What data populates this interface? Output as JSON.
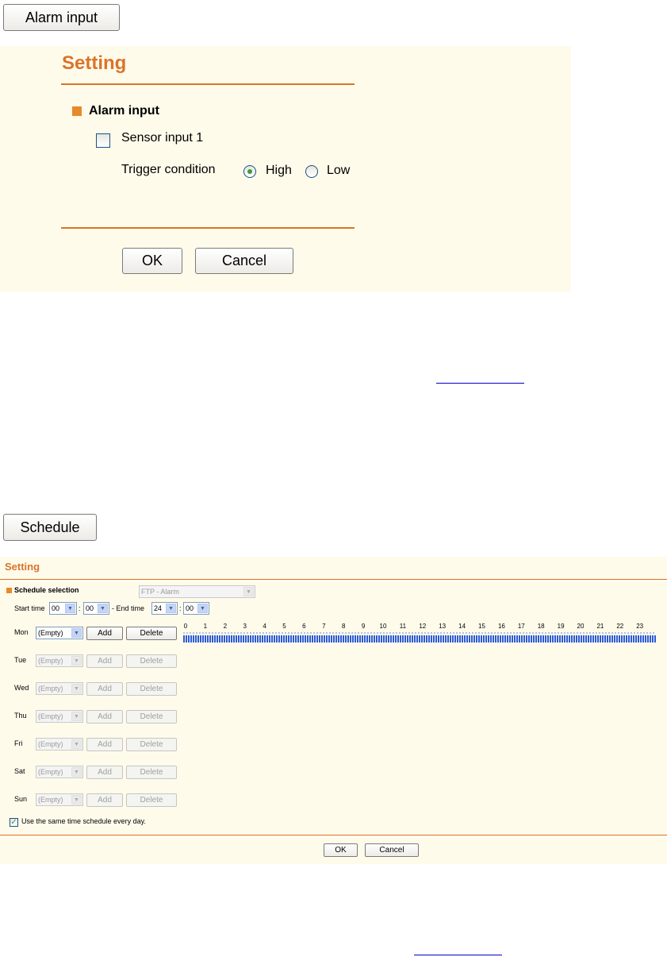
{
  "alarm_button": "Alarm input",
  "alarm_panel": {
    "title": "Setting",
    "section": "Alarm input",
    "sensor_label": "Sensor input 1",
    "sensor_checked": false,
    "trigger_label": "Trigger condition",
    "high_label": "High",
    "low_label": "Low",
    "selected_trigger": "High",
    "ok": "OK",
    "cancel": "Cancel"
  },
  "schedule_button": "Schedule",
  "schedule_panel": {
    "title": "Setting",
    "section": "Schedule selection",
    "selection_value": "FTP - Alarm",
    "start_label": "Start time",
    "start_hour": "00",
    "start_min": "00",
    "end_label": "- End time",
    "end_hour": "24",
    "end_min": "00",
    "colon": ":",
    "hours": [
      "0",
      "1",
      "2",
      "3",
      "4",
      "5",
      "6",
      "7",
      "8",
      "9",
      "10",
      "11",
      "12",
      "13",
      "14",
      "15",
      "16",
      "17",
      "18",
      "19",
      "20",
      "21",
      "22",
      "23"
    ],
    "days": [
      {
        "name": "Mon",
        "value": "(Empty)",
        "enabled": true
      },
      {
        "name": "Tue",
        "value": "(Empty)",
        "enabled": false
      },
      {
        "name": "Wed",
        "value": "(Empty)",
        "enabled": false
      },
      {
        "name": "Thu",
        "value": "(Empty)",
        "enabled": false
      },
      {
        "name": "Fri",
        "value": "(Empty)",
        "enabled": false
      },
      {
        "name": "Sat",
        "value": "(Empty)",
        "enabled": false
      },
      {
        "name": "Sun",
        "value": "(Empty)",
        "enabled": false
      }
    ],
    "add": "Add",
    "delete": "Delete",
    "same_schedule": "Use the same time schedule every day.",
    "same_schedule_checked": true,
    "ok": "OK",
    "cancel": "Cancel"
  },
  "colors": {
    "accent": "#d9742a",
    "panel_bg": "#fffbeb",
    "timeline": "#2a5bd7",
    "link": "#0000cc"
  }
}
